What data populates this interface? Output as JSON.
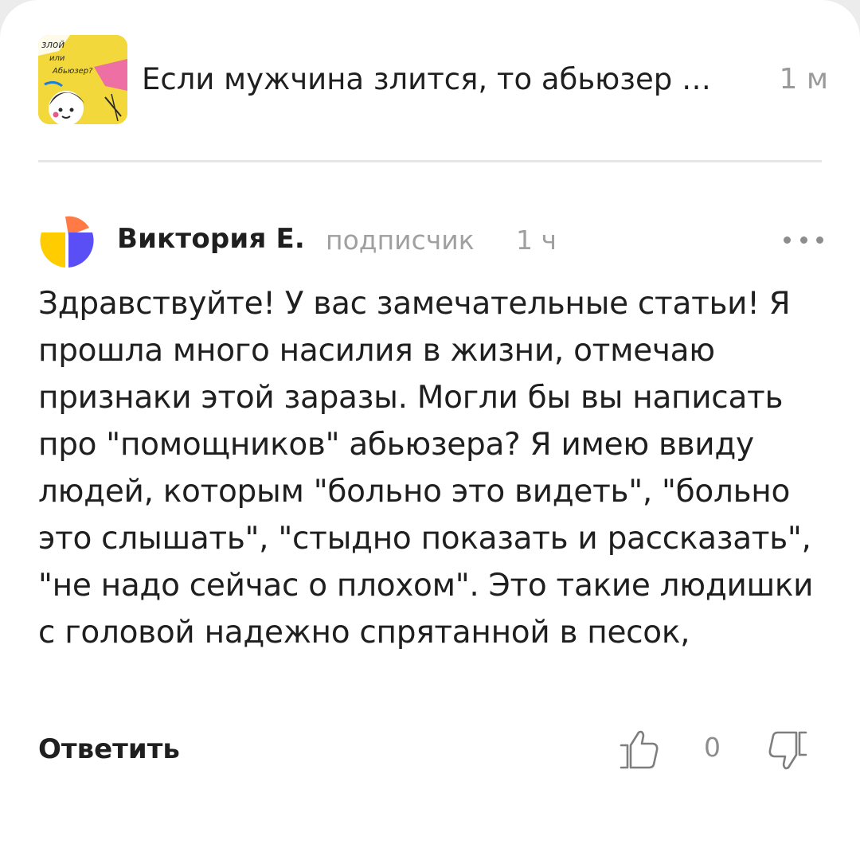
{
  "article": {
    "thumb_text_1": "злой",
    "thumb_text_2": "или",
    "thumb_text_3": "Абьюзер?",
    "title": "Если мужчина злится, то абьюзер …",
    "time": "1 м"
  },
  "comment": {
    "author": "Виктория Е.",
    "subscriber_label": "подписчик",
    "time": "1 ч",
    "text": "Здравствуйте! У вас замечательные статьи! Я прошла много насилия в жизни, отмечаю признаки этой заразы. Могли бы вы написать про \"помощников\" абьюзера? Я имею ввиду людей, которым \"больно это видеть\", \"больно это слышать\", \"стыдно показать и рассказать\", \"не надо сейчас о плохом\". Это такие людишки с головой надежно спрятанной в песок,",
    "reply_label": "Ответить",
    "like_count": "0"
  },
  "icons": {
    "avatar": "yandex-avatar-icon",
    "more": "more-dots-icon",
    "like": "thumbs-up-icon",
    "dislike": "thumbs-down-icon"
  },
  "colors": {
    "avatar_yellow": "#ffcc00",
    "avatar_blue": "#5a4ff5",
    "avatar_orange": "#ff7a45",
    "thumb_yellow": "#f2d83a"
  }
}
